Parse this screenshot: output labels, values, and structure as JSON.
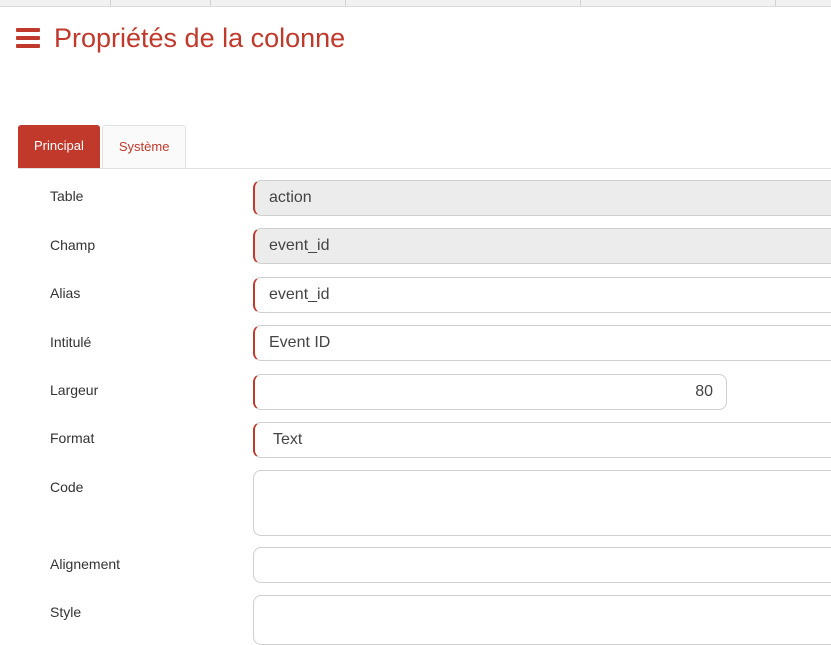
{
  "header": {
    "title": "Propriétés de la colonne"
  },
  "tabs": [
    {
      "label": "Principal",
      "active": true
    },
    {
      "label": "Système",
      "active": false
    }
  ],
  "form": {
    "table": {
      "label": "Table",
      "value": "action"
    },
    "champ": {
      "label": "Champ",
      "value": "event_id"
    },
    "alias": {
      "label": "Alias",
      "value": "event_id"
    },
    "intitule": {
      "label": "Intitulé",
      "value": "Event ID"
    },
    "largeur": {
      "label": "Largeur",
      "value": "80"
    },
    "format": {
      "label": "Format",
      "value": "Text"
    },
    "code": {
      "label": "Code",
      "value": ""
    },
    "alignement": {
      "label": "Alignement",
      "value": ""
    },
    "style": {
      "label": "Style",
      "value": ""
    }
  },
  "colors": {
    "accent": "#c0392b",
    "readonly_bg": "#ececec",
    "border": "#cfcfcf"
  }
}
